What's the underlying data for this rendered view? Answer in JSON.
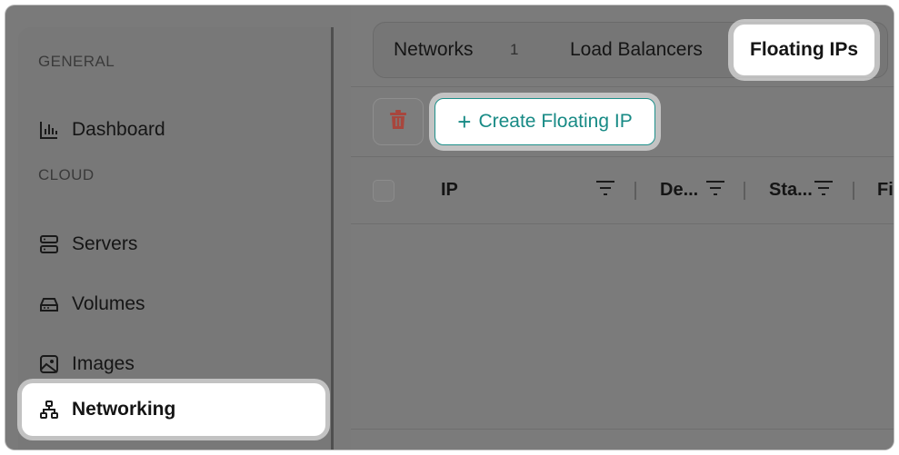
{
  "sidebar": {
    "sections": [
      {
        "label": "GENERAL"
      },
      {
        "label": "CLOUD"
      }
    ],
    "items": [
      {
        "label": "Dashboard",
        "icon": "bar-chart-icon"
      },
      {
        "label": "Servers",
        "icon": "server-icon"
      },
      {
        "label": "Volumes",
        "icon": "hard-drive-icon"
      },
      {
        "label": "Images",
        "icon": "image-icon"
      },
      {
        "label": "Networking",
        "icon": "network-icon",
        "active": true
      }
    ]
  },
  "tabs": [
    {
      "label": "Networks",
      "count": "1"
    },
    {
      "label": "Load Balancers"
    },
    {
      "label": "Floating IPs",
      "active": true
    }
  ],
  "toolbar": {
    "delete_icon": "trash-icon",
    "create_label": "Create Floating IP",
    "create_icon": "plus-icon"
  },
  "table": {
    "columns": [
      "IP",
      "De...",
      "Sta...",
      "Fi"
    ]
  },
  "colors": {
    "accent": "#178a85",
    "danger": "#c0392b",
    "overlay": "#7a7a7a"
  }
}
